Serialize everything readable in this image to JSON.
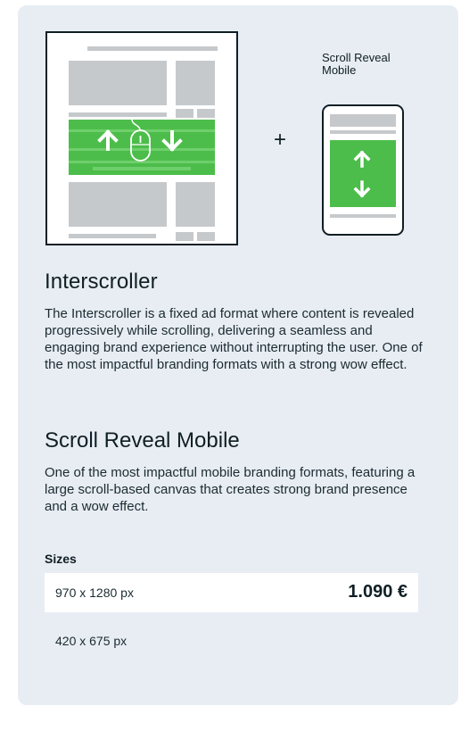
{
  "illustration": {
    "mobile_caption_line1": "Scroll Reveal",
    "mobile_caption_line2": "Mobile",
    "plus_sign": "+",
    "colors": {
      "green": "#4cbd4a",
      "placeholder_gray": "#c6c9cb",
      "frame": "#0f1f24"
    }
  },
  "formats": [
    {
      "title": "Interscroller",
      "description": "The Interscroller is a fixed ad format where content is revealed progressively while scrolling, delivering a seamless and engaging brand experience without interrupting the user. One of the most impactful branding formats with a strong wow effect."
    },
    {
      "title": "Scroll Reveal Mobile",
      "description": "One of the most impactful mobile branding formats, featuring a large scroll-based canvas that creates strong brand presence and a wow effect."
    }
  ],
  "sizes": {
    "label": "Sizes",
    "options": [
      {
        "label": "970 x 1280 px",
        "price": "1.090 €",
        "selected": true
      },
      {
        "label": "420 x 675 px",
        "selected": false
      }
    ]
  }
}
